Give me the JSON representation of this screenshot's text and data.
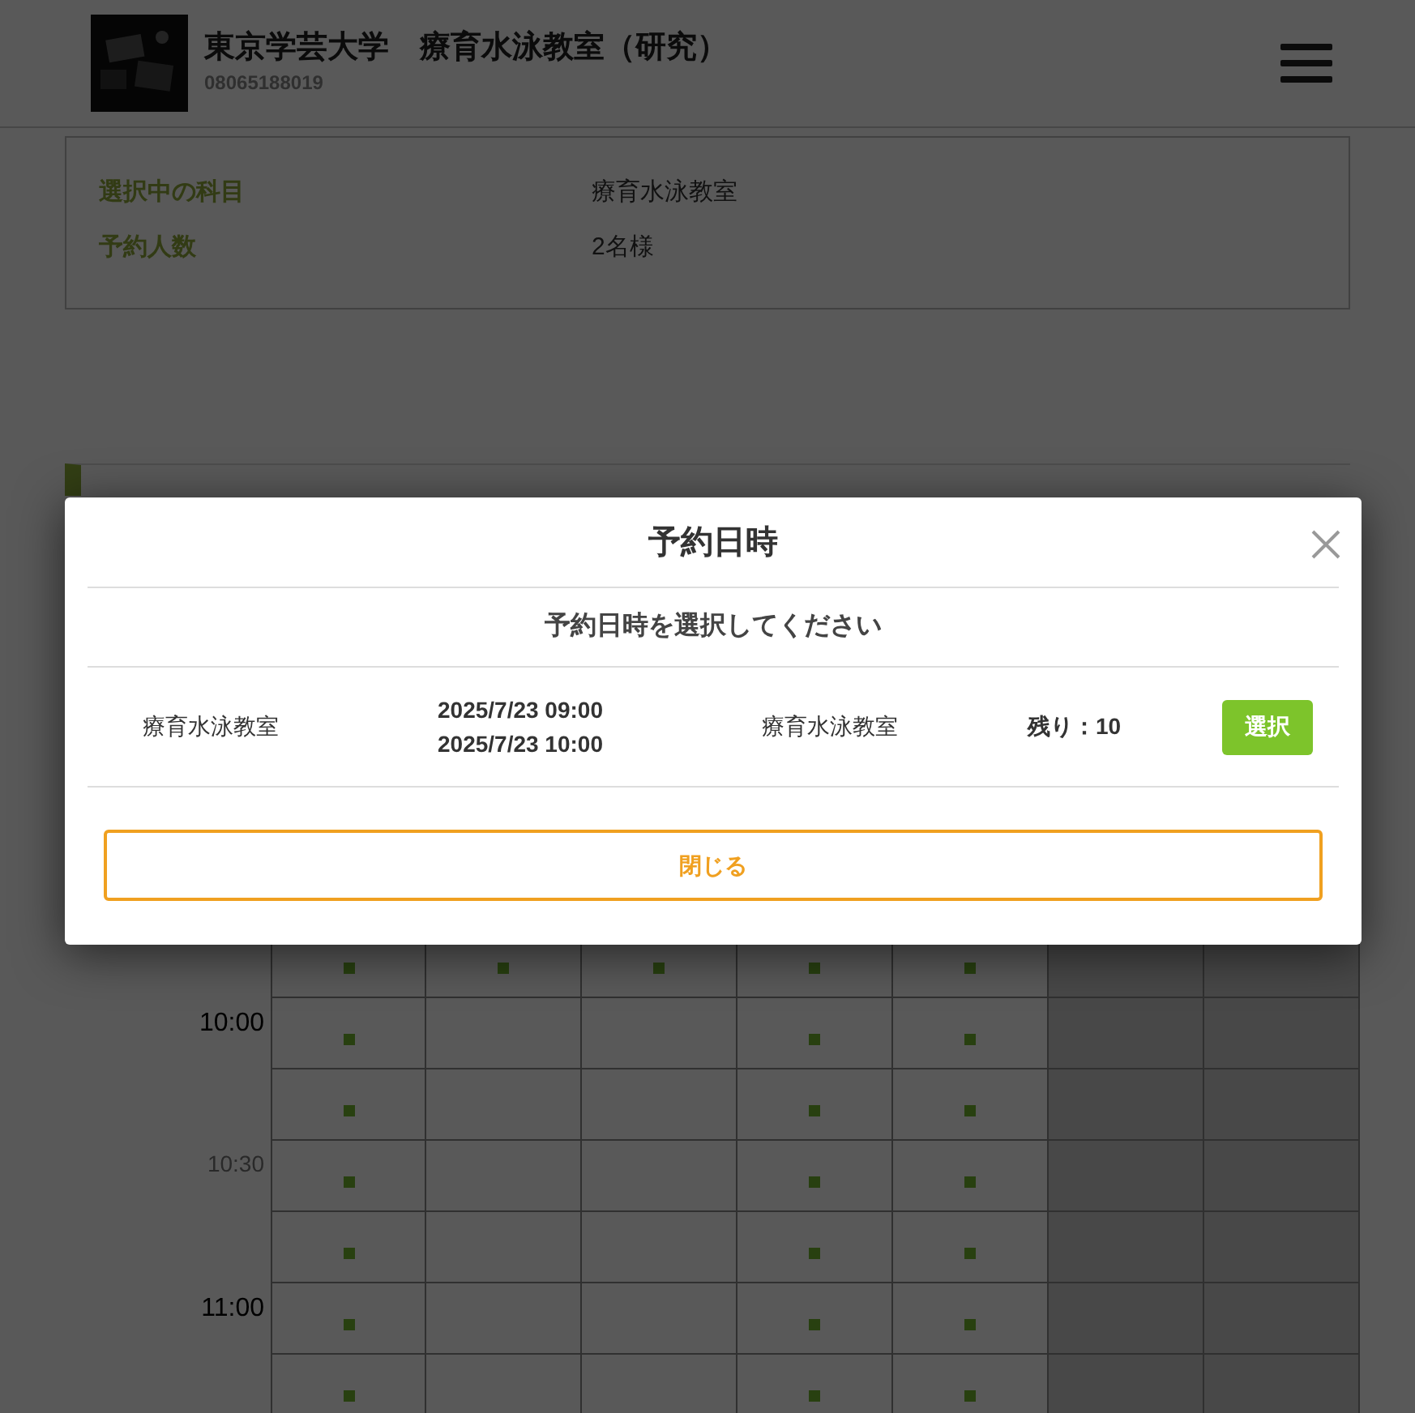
{
  "header": {
    "title": "東京学芸大学　療育水泳教室（研究）",
    "phone": "08065188019"
  },
  "summary": [
    {
      "label": "選択中の科目",
      "value": "療育水泳教室"
    },
    {
      "label": "予約人数",
      "value": "2名様"
    }
  ],
  "schedule": {
    "columns": [
      {
        "shaded": false
      },
      {
        "shaded": false
      },
      {
        "shaded": false
      },
      {
        "shaded": false
      },
      {
        "shaded": false
      },
      {
        "shaded": true
      },
      {
        "shaded": true
      }
    ],
    "rows": [
      {
        "marks": [
          true,
          true,
          true,
          true,
          true,
          false,
          false
        ]
      },
      {
        "time": "10:00",
        "minor": false,
        "marks": [
          true,
          false,
          false,
          true,
          true,
          false,
          false
        ]
      },
      {
        "marks": [
          true,
          false,
          false,
          true,
          true,
          false,
          false
        ]
      },
      {
        "time": "10:30",
        "minor": true,
        "marks": [
          true,
          false,
          false,
          true,
          true,
          false,
          false
        ]
      },
      {
        "marks": [
          true,
          false,
          false,
          true,
          true,
          false,
          false
        ]
      },
      {
        "time": "11:00",
        "minor": false,
        "marks": [
          true,
          false,
          false,
          true,
          true,
          false,
          false
        ]
      },
      {
        "marks": [
          true,
          false,
          false,
          true,
          true,
          false,
          false
        ]
      }
    ]
  },
  "modal": {
    "title": "予約日時",
    "subtitle": "予約日時を選択してください",
    "slots": [
      {
        "course": "療育水泳教室",
        "start": "2025/7/23 09:00",
        "end": "2025/7/23 10:00",
        "place": "療育水泳教室",
        "remaining": "残り：10",
        "button": "選択"
      }
    ],
    "close": "閉じる"
  }
}
